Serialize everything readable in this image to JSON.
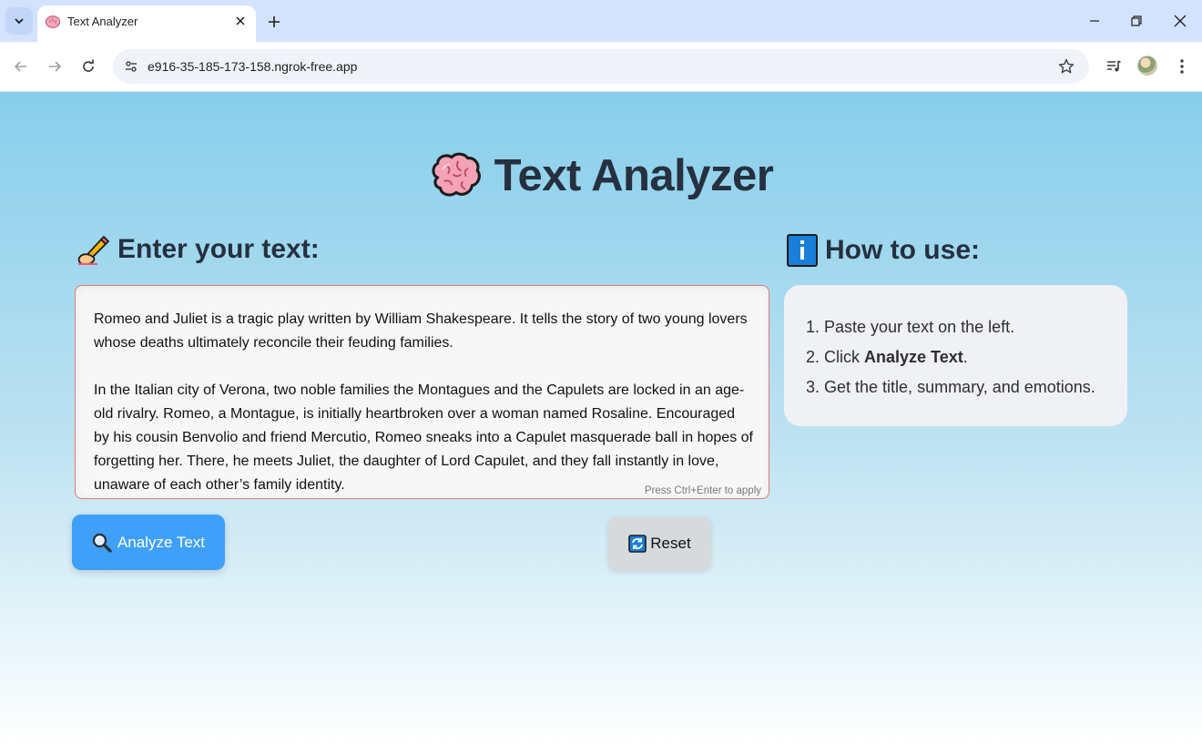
{
  "browser": {
    "tab_title": "Text Analyzer",
    "url": "e916-35-185-173-158.ngrok-free.app"
  },
  "app": {
    "title": "Text Analyzer",
    "input_heading": "Enter your text:",
    "info_heading": "How to use:",
    "text_paragraph_1": "Romeo and Juliet is a tragic play written by William Shakespeare. It tells the story of two young lovers whose deaths ultimately reconcile their feuding families.",
    "text_paragraph_2": "In the Italian city of Verona, two noble families the Montagues and the Capulets are locked in an age-old rivalry. Romeo, a Montague, is initially heartbroken over a woman named Rosaline. Encouraged by his cousin Benvolio and friend Mercutio, Romeo sneaks into a Capulet masquerade ball in hopes of forgetting her. There, he meets Juliet, the daughter of Lord Capulet, and they fall instantly in love, unaware of each other’s family identity.",
    "textarea_hint": "Press Ctrl+Enter to apply",
    "analyze_label": "Analyze Text",
    "reset_label": "Reset",
    "steps": {
      "step1": "1. Paste your text on the left.",
      "step2_prefix": "2. Click ",
      "step2_bold": "Analyze Text",
      "step2_suffix": ".",
      "step3": "3. Get the title, summary, and emotions."
    }
  },
  "colors": {
    "analyze_button": "#3fa0fa",
    "reset_button": "#d6dadd",
    "textarea_border": "#e07a7a",
    "title_text": "#26303f"
  }
}
